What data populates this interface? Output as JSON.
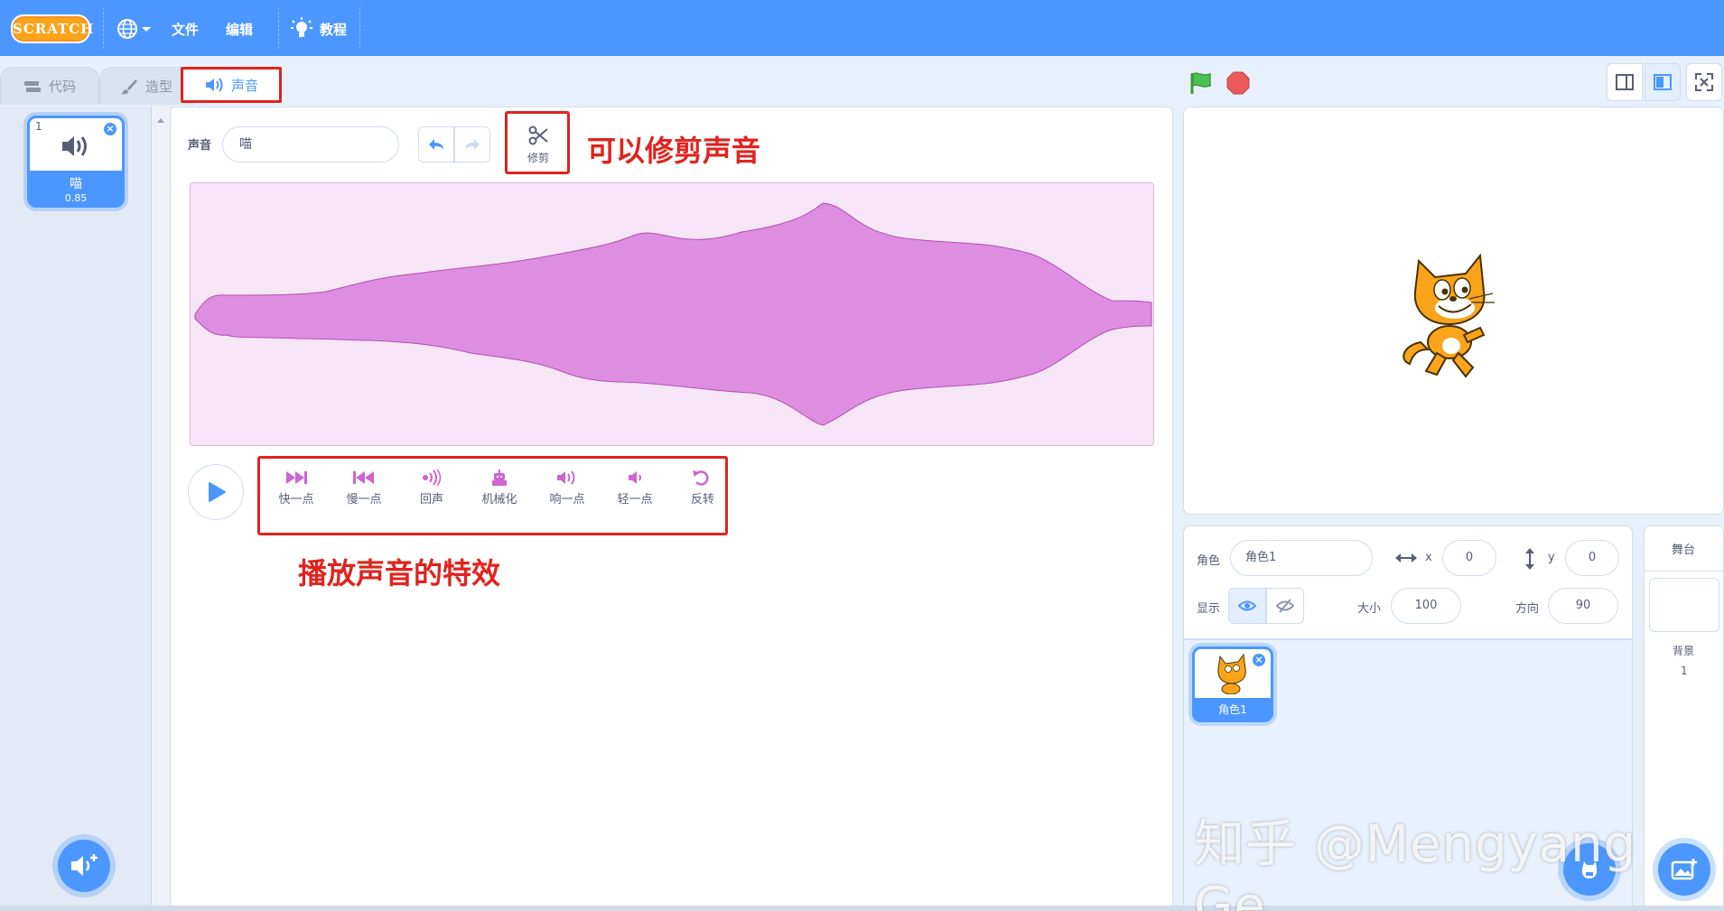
{
  "menu": {
    "logo_text": "SCRATCH",
    "file": "文件",
    "edit": "编辑",
    "tutorials": "教程"
  },
  "tabs": [
    {
      "label": "代码"
    },
    {
      "label": "造型"
    },
    {
      "label": "声音"
    }
  ],
  "sound_list": {
    "items": [
      {
        "index": "1",
        "name": "喵",
        "duration": "0.85"
      }
    ]
  },
  "editor": {
    "sound_label": "声音",
    "sound_name": "喵",
    "trim_label": "修剪",
    "effects": [
      {
        "label": "快一点",
        "icon": "faster-icon"
      },
      {
        "label": "慢一点",
        "icon": "slower-icon"
      },
      {
        "label": "回声",
        "icon": "echo-icon"
      },
      {
        "label": "机械化",
        "icon": "robot-icon"
      },
      {
        "label": "响一点",
        "icon": "louder-icon"
      },
      {
        "label": "轻一点",
        "icon": "softer-icon"
      },
      {
        "label": "反转",
        "icon": "reverse-icon"
      }
    ]
  },
  "annotations": {
    "trim_note": "可以修剪声音",
    "effects_note": "播放声音的特效"
  },
  "sprite_info": {
    "sprite_label": "角色",
    "sprite_name": "角色1",
    "x_label": "x",
    "x_value": "0",
    "y_label": "y",
    "y_value": "0",
    "show_label": "显示",
    "size_label": "大小",
    "size_value": "100",
    "direction_label": "方向",
    "direction_value": "90"
  },
  "sprites": [
    {
      "name": "角色1"
    }
  ],
  "stage_panel": {
    "title": "舞台",
    "backdrops_label": "背景",
    "backdrops_count": "1"
  },
  "watermark": "知乎 @Mengyang Ge",
  "colors": {
    "accent": "#4c97ff",
    "annotation_red": "#e0231e",
    "wave_fill": "#dd8ee0",
    "effect_icon": "#cf63cf"
  }
}
